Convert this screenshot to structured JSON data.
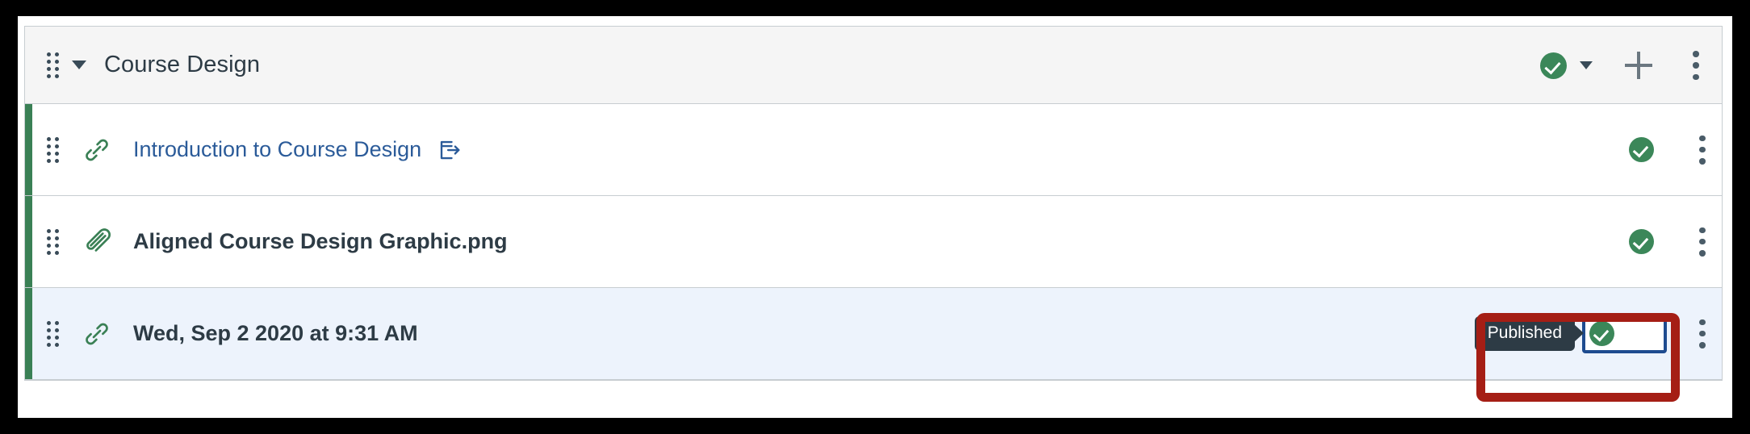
{
  "module": {
    "title": "Course Design",
    "drag_handle_name": "drag-handle",
    "collapse_caret": "chevron-down-icon",
    "header_controls": {
      "publish_status": "Published",
      "publish_icon": "published-check-icon",
      "publish_dropdown_icon": "chevron-down-icon",
      "add_icon": "plus-icon",
      "menu_icon": "kebab-menu-icon"
    }
  },
  "items": [
    {
      "title": "Introduction to Course Design",
      "type_icon": "link-icon",
      "title_style": "link",
      "has_launch_icon": true,
      "launch_icon": "external-link-icon",
      "published": true,
      "publish_icon": "published-check-icon",
      "menu_icon": "kebab-menu-icon",
      "highlighted": false,
      "focused": false
    },
    {
      "title": "Aligned Course Design Graphic.png",
      "type_icon": "paperclip-icon",
      "title_style": "bold",
      "has_launch_icon": false,
      "launch_icon": "",
      "published": true,
      "publish_icon": "published-check-icon",
      "menu_icon": "kebab-menu-icon",
      "highlighted": false,
      "focused": false
    },
    {
      "title": "Wed, Sep 2 2020 at 9:31 AM",
      "type_icon": "link-icon",
      "title_style": "bold",
      "has_launch_icon": false,
      "launch_icon": "",
      "published": true,
      "publish_icon": "published-check-icon",
      "menu_icon": "kebab-menu-icon",
      "highlighted": true,
      "focused": true,
      "tooltip": "Published"
    }
  ],
  "annotation": {
    "shape": "rectangle",
    "color": "#A51E15",
    "target": "publish-toggle-row-3"
  },
  "colors": {
    "published_green": "#3B8759",
    "status_bar_green": "#3A8055",
    "link_blue": "#2B5B99",
    "focus_blue": "#1E4B8F",
    "tooltip_dark": "#2D3B45",
    "row_highlight": "#edf3fc",
    "header_gray": "#f5f5f5",
    "border_gray": "#c7cdd1",
    "annotation_red": "#A51E15"
  }
}
